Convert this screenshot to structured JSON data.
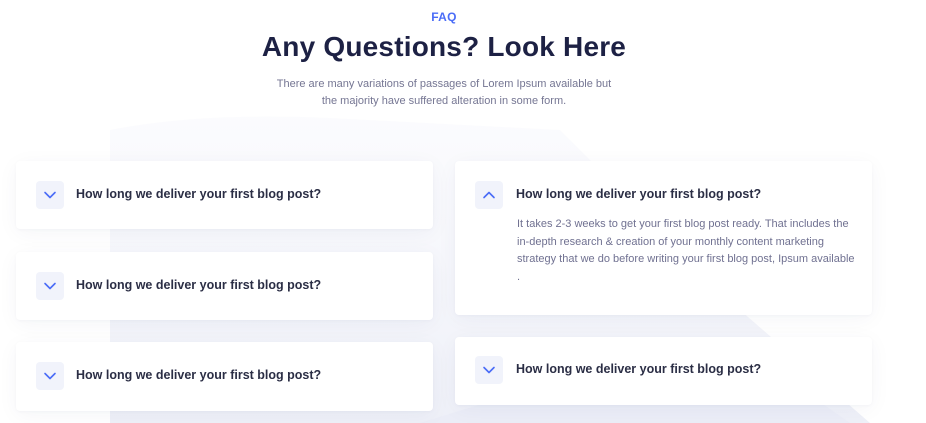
{
  "section": {
    "eyebrow": "FAQ",
    "title": "Any Questions? Look Here",
    "subtitle_line1": "There are many variations of passages of Lorem Ipsum available but",
    "subtitle_line2": "the majority have suffered alteration in some form."
  },
  "faq": {
    "items": [
      {
        "question": "How long we deliver your first blog post?",
        "expanded": false
      },
      {
        "question": "How long we deliver your first blog post?",
        "expanded": false
      },
      {
        "question": "How long we deliver your first blog post?",
        "expanded": false
      },
      {
        "question": "How long we deliver your first blog post?",
        "expanded": true,
        "answer": "It takes 2-3 weeks to get your first blog post ready. That includes the in-depth research & creation of your monthly content marketing strategy that we do before writing your first blog post, Ipsum available ."
      },
      {
        "question": "How long we deliver your first blog post?",
        "expanded": false
      }
    ]
  },
  "colors": {
    "accent": "#4a6cf7",
    "heading": "#1d2144",
    "body_text": "#757693",
    "icon_bg": "#f1f3fb"
  },
  "icons": {
    "collapsed": "chevron-down-icon",
    "expanded": "chevron-up-icon"
  }
}
